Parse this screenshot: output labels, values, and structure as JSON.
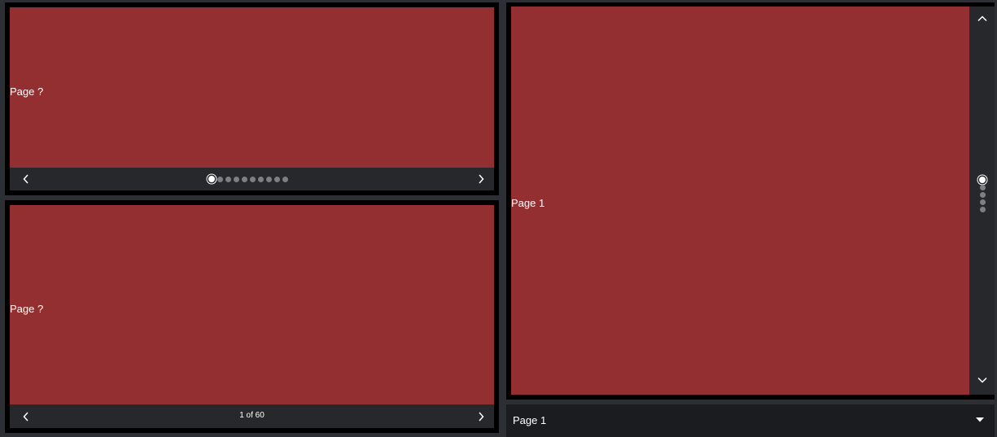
{
  "carousel_top": {
    "page_label": "Page ?",
    "prev_icon": "chevron-left-icon",
    "next_icon": "chevron-right-icon",
    "dots": [
      {
        "active": true
      },
      {
        "active": false
      },
      {
        "active": false
      },
      {
        "active": false
      },
      {
        "active": false
      },
      {
        "active": false
      },
      {
        "active": false
      },
      {
        "active": false
      },
      {
        "active": false
      },
      {
        "active": false
      }
    ]
  },
  "carousel_bottom": {
    "page_label": "Page ?",
    "counter": "1 of 60",
    "prev_icon": "chevron-left-icon",
    "next_icon": "chevron-right-icon"
  },
  "carousel_vertical": {
    "page_label": "Page 1",
    "up_icon": "chevron-up-icon",
    "down_icon": "chevron-down-icon",
    "dots": [
      {
        "active": true
      },
      {
        "active": false
      },
      {
        "active": false
      },
      {
        "active": false
      },
      {
        "active": false
      }
    ]
  },
  "page_select": {
    "value": "Page 1",
    "icon": "caret-down-icon"
  },
  "colors": {
    "page_background": "#932f30",
    "panel_border": "#000000",
    "nav_bar": "#26282b",
    "app_background": "#2c2f33",
    "dot_inactive": "#7c7f84",
    "dot_active": "#ffffff",
    "dropdown_background": "#1a1c1f"
  }
}
